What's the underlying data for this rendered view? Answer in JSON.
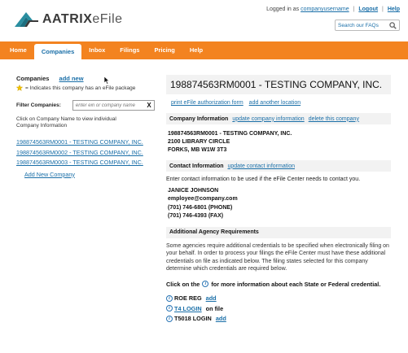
{
  "brand": {
    "name": "AATRIX",
    "suffix": "eFile",
    "colors": {
      "teal": "#2a8ea0",
      "dark": "#3a3a3a",
      "orange": "#f38320",
      "link": "#1a6fa8"
    }
  },
  "topbar": {
    "logged_in_prefix": "Logged in as",
    "username": "companyusername",
    "logout": "Logout",
    "help": "Help",
    "search_placeholder": "Search our FAQs"
  },
  "nav": {
    "items": [
      {
        "label": "Home"
      },
      {
        "label": "Companies",
        "active": true
      },
      {
        "label": "Inbox"
      },
      {
        "label": "Filings"
      },
      {
        "label": "Pricing"
      },
      {
        "label": "Help"
      }
    ]
  },
  "left": {
    "title": "Companies",
    "add_new": "add new",
    "legend_text": "= Indicates this company has an eFile package",
    "filter_label": "Filter Companies:",
    "filter_placeholder": "enter ein or company name",
    "clear": "X",
    "hint": "Click on Company Name to view individual Company Information",
    "companies": [
      "198874563RM0001 - TESTING COMPANY, INC.",
      "198874563RM0002 - TESTING COMPANY, INC.",
      "198874563RM0003 - TESTING COMPANY, INC."
    ],
    "add_company": "Add New Company"
  },
  "main": {
    "title": "198874563RM0001 - TESTING COMPANY, INC.",
    "print_link": "print eFile authorization form",
    "add_location": "add another location",
    "company_info": {
      "heading": "Company Information",
      "update": "update company information",
      "delete": "delete this company",
      "address": [
        "198874563RM0001 - TESTING COMPANY, INC.",
        "2100 LIBRARY CIRCLE",
        "FORKS, MB W1W 3T3"
      ]
    },
    "contact_info": {
      "heading": "Contact Information",
      "update": "update contact information",
      "description": "Enter contact information to be used if the eFile Center needs to contact you.",
      "details": [
        "JANICE JOHNSON",
        "employee@company.com",
        "(701) 746-6801 (PHONE)",
        "(701) 746-4393 (FAX)"
      ]
    },
    "agency": {
      "heading": "Additional Agency Requirements",
      "description": "Some agencies require additional credentials to be specified when electronically filing on your behalf. In order to process your filings the eFile Center must have these additional credentials on file as indicated below. The filing states selected for this company determine which credentials are required below.",
      "click_before": "Click on the",
      "click_after": "for more information about each State or Federal credential.",
      "credentials": [
        {
          "name": "ROE REG",
          "action": "add"
        },
        {
          "name": "T4 LOGIN",
          "status": "on file"
        },
        {
          "name": "T5018 LOGIN",
          "action": "add"
        }
      ]
    }
  }
}
